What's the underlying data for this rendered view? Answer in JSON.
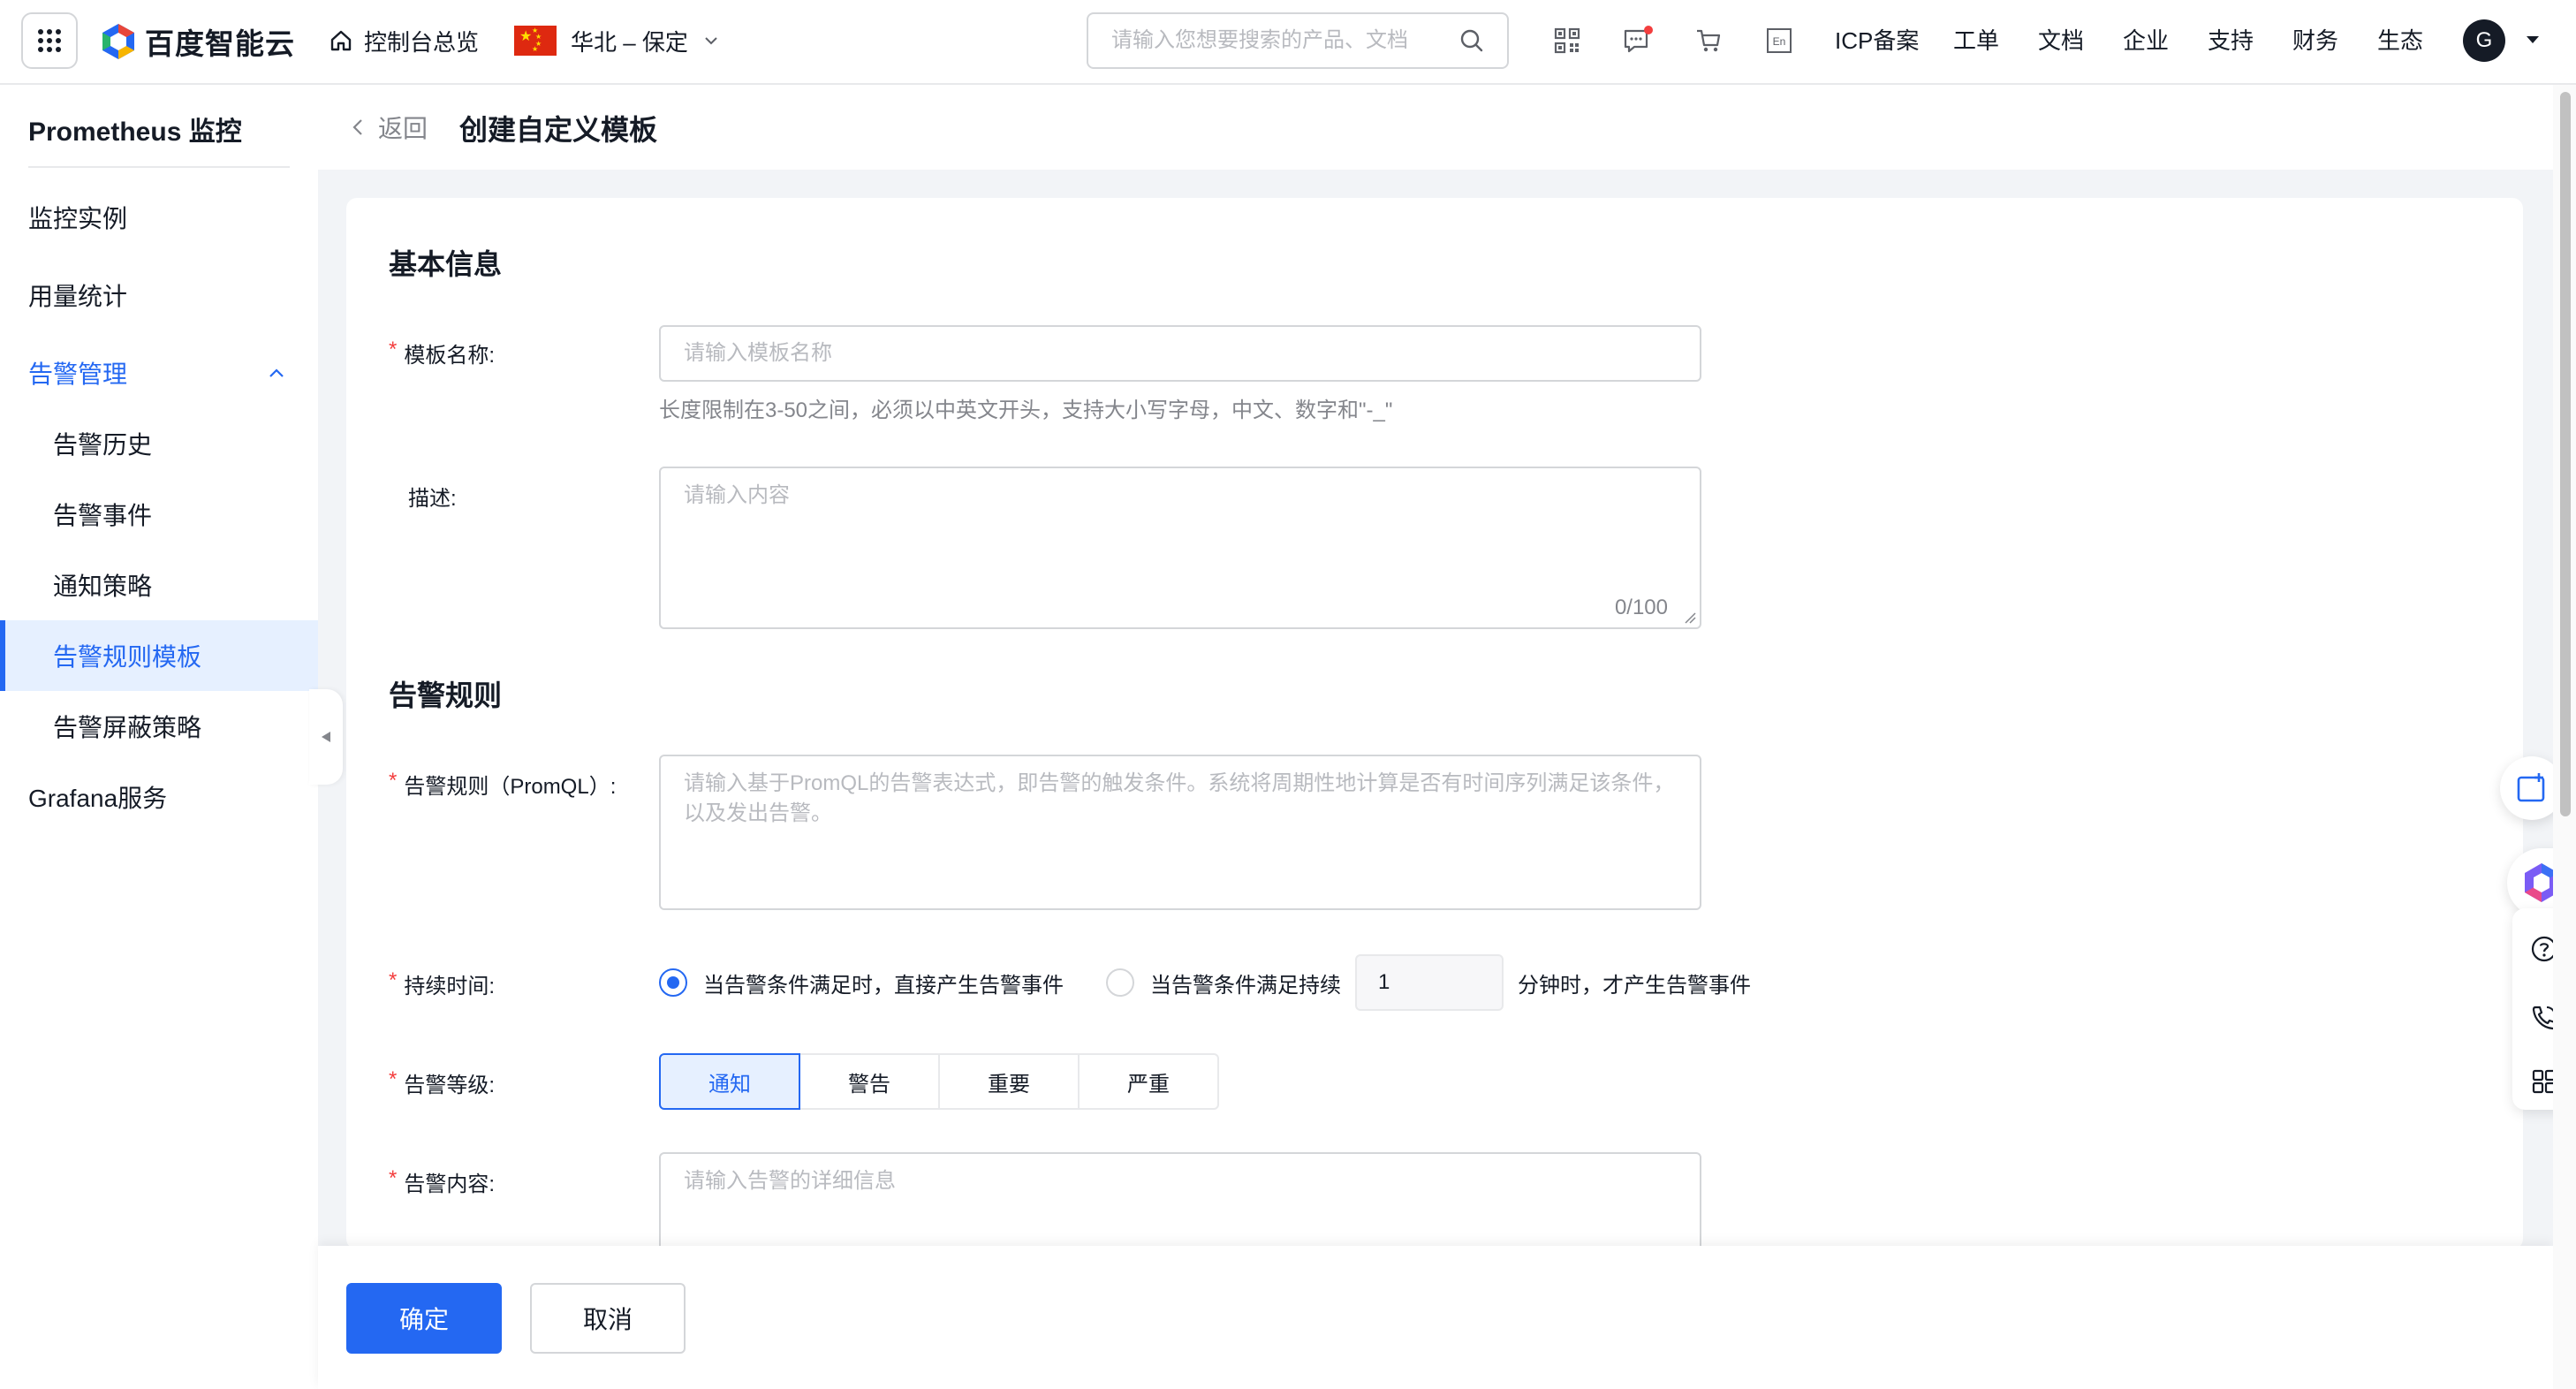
{
  "topbar": {
    "brand": "百度智能云",
    "overview": "控制台总览",
    "region": "华北 – 保定",
    "search_placeholder": "请输入您想要搜索的产品、文档",
    "links": [
      "ICP备案",
      "工单",
      "文档",
      "企业",
      "支持",
      "财务",
      "生态"
    ],
    "avatar_letter": "G",
    "colors": {
      "primary": "#2468f2",
      "notification_dot": "#f33e3e"
    }
  },
  "sidebar": {
    "title": "Prometheus 监控",
    "items": [
      {
        "label": "监控实例"
      },
      {
        "label": "用量统计"
      },
      {
        "label": "告警管理"
      },
      {
        "label": "告警历史"
      },
      {
        "label": "告警事件"
      },
      {
        "label": "通知策略"
      },
      {
        "label": "告警规则模板"
      },
      {
        "label": "告警屏蔽策略"
      },
      {
        "label": "Grafana服务"
      }
    ]
  },
  "page": {
    "back": "返回",
    "title": "创建自定义模板"
  },
  "form": {
    "basic_title": "基本信息",
    "name_label": "模板名称:",
    "name_placeholder": "请输入模板名称",
    "name_hint": "长度限制在3-50之间，必须以中英文开头，支持大小写字母，中文、数字和\"-_\"",
    "desc_label": "描述:",
    "desc_placeholder": "请输入内容",
    "desc_counter": "0/100",
    "rule_title": "告警规则",
    "promql_label": "告警规则（PromQL）:",
    "promql_placeholder": "请输入基于PromQL的告警表达式，即告警的触发条件。系统将周期性地计算是否有时间序列满足该条件，以及发出告警。",
    "duration_label": "持续时间:",
    "duration_opt1": "当告警条件满足时，直接产生告警事件",
    "duration_opt2": "当告警条件满足持续",
    "duration_value": "1",
    "duration_suffix": "分钟时，才产生告警事件",
    "level_label": "告警等级:",
    "levels": [
      "通知",
      "警告",
      "重要",
      "严重"
    ],
    "selected_level": "通知",
    "content_label": "告警内容:",
    "content_placeholder": "请输入告警的详细信息"
  },
  "footer": {
    "confirm": "确定",
    "cancel": "取消"
  }
}
